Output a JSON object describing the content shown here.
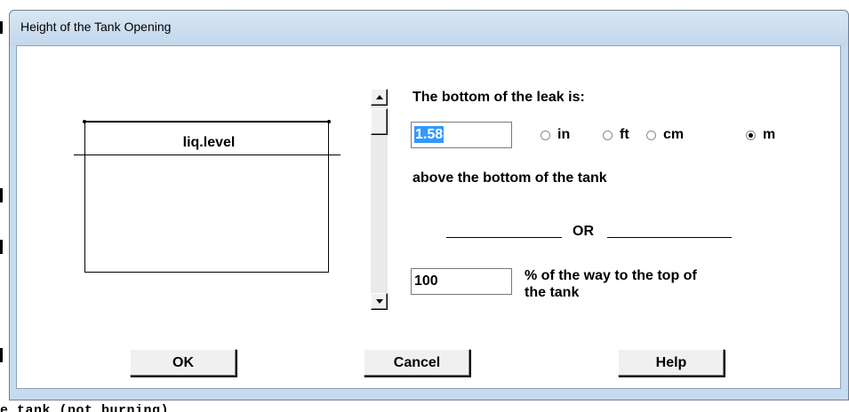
{
  "window": {
    "title": "Height of the Tank Opening"
  },
  "background": {
    "top_text": "",
    "bottom_text": "e tank (not burning)"
  },
  "diagram": {
    "liq_label": "liq.level"
  },
  "leak": {
    "heading": "The bottom of the leak is:",
    "value": "1.58",
    "units": [
      {
        "label": "in",
        "checked": false
      },
      {
        "label": "ft",
        "checked": false
      },
      {
        "label": "cm",
        "checked": false
      },
      {
        "label": "m",
        "checked": true
      }
    ],
    "above_text": "above the bottom of the tank",
    "or_text": "OR",
    "percent_value": "100",
    "percent_text_1": "% of the way to the top of",
    "percent_text_2": "the tank"
  },
  "buttons": {
    "ok": "OK",
    "cancel": "Cancel",
    "help": "Help"
  }
}
